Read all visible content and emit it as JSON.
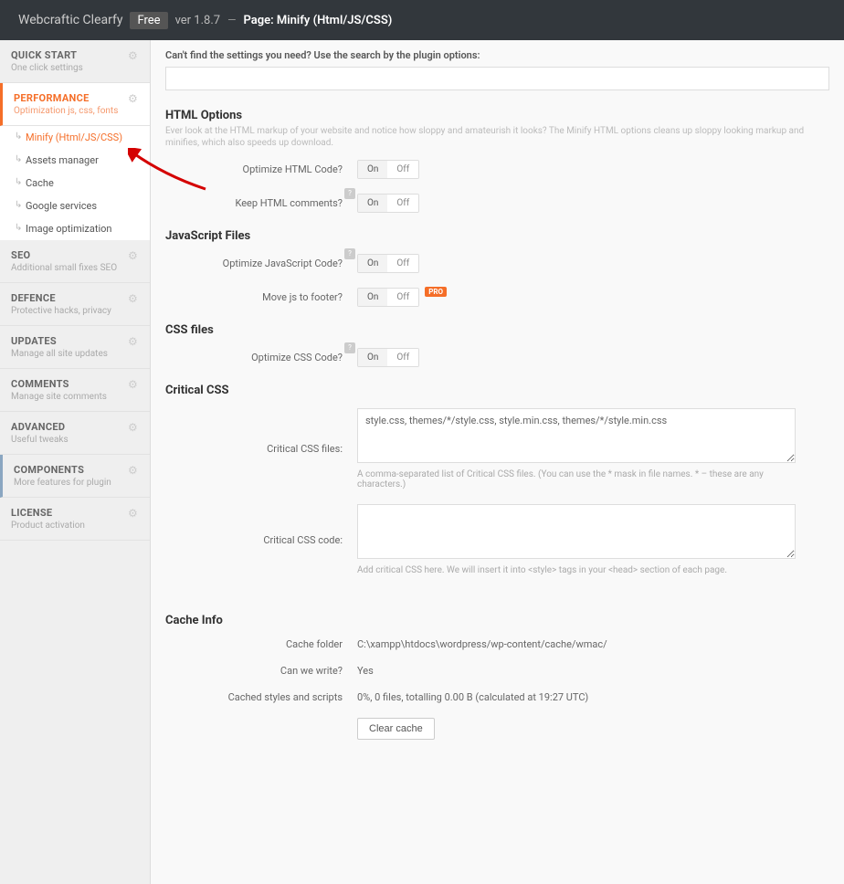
{
  "topbar": {
    "brand": "Webcraftic Clearfy",
    "plan": "Free",
    "version": "ver 1.8.7",
    "sep": "—",
    "page_prefix": "Page:",
    "page": "Minify (Html/JS/CSS)"
  },
  "sidebar": {
    "groups": [
      {
        "title": "QUICK START",
        "sub": "One click settings"
      },
      {
        "title": "PERFORMANCE",
        "sub": "Optimization js, css, fonts",
        "active": true,
        "items": [
          {
            "label": "Minify (Html/JS/CSS)",
            "sel": true
          },
          {
            "label": "Assets manager"
          },
          {
            "label": "Cache"
          },
          {
            "label": "Google services"
          },
          {
            "label": "Image optimization"
          }
        ]
      },
      {
        "title": "SEO",
        "sub": "Additional small fixes SEO"
      },
      {
        "title": "DEFENCE",
        "sub": "Protective hacks, privacy"
      },
      {
        "title": "UPDATES",
        "sub": "Manage all site updates"
      },
      {
        "title": "COMMENTS",
        "sub": "Manage site comments"
      },
      {
        "title": "ADVANCED",
        "sub": "Useful tweaks"
      },
      {
        "title": "COMPONENTS",
        "sub": "More features for plugin",
        "components": true
      },
      {
        "title": "LICENSE",
        "sub": "Product activation"
      }
    ]
  },
  "search": {
    "label": "Can't find the settings you need? Use the search by the plugin options:",
    "value": ""
  },
  "sections": {
    "html": {
      "title": "HTML Options",
      "desc": "Ever look at the HTML markup of your website and notice how sloppy and amateurish it looks? The Minify HTML options cleans up sloppy looking markup and minifies, which also speeds up download.",
      "rows": [
        {
          "label": "Optimize HTML Code?",
          "on": "On",
          "off": "Off"
        },
        {
          "label": "Keep HTML comments?",
          "on": "On",
          "off": "Off",
          "hint": "?"
        }
      ]
    },
    "js": {
      "title": "JavaScript Files",
      "rows": [
        {
          "label": "Optimize JavaScript Code?",
          "on": "On",
          "off": "Off",
          "hint": "?"
        },
        {
          "label": "Move js to footer?",
          "on": "On",
          "off": "Off",
          "pro": "PRO"
        }
      ]
    },
    "css": {
      "title": "CSS files",
      "rows": [
        {
          "label": "Optimize CSS Code?",
          "on": "On",
          "off": "Off",
          "hint": "?"
        }
      ]
    },
    "critical": {
      "title": "Critical CSS",
      "files_label": "Critical CSS files:",
      "files_value": "style.css, themes/*/style.css, style.min.css, themes/*/style.min.css",
      "files_help": "A comma-separated list of Critical CSS files. (You can use the * mask in file names. * – these are any characters.)",
      "code_label": "Critical CSS code:",
      "code_value": "",
      "code_help": "Add critical CSS here. We will insert it into <style> tags in your <head> section of each page."
    },
    "cache": {
      "title": "Cache Info",
      "rows": [
        {
          "label": "Cache folder",
          "value": "C:\\xampp\\htdocs\\wordpress/wp-content/cache/wmac/"
        },
        {
          "label": "Can we write?",
          "value": "Yes"
        },
        {
          "label": "Cached styles and scripts",
          "value": "0%, 0 files, totalling 0.00 B (calculated at 19:27 UTC)"
        }
      ],
      "clear_btn": "Clear cache"
    }
  },
  "toggle_labels": {
    "on": "On",
    "off": "Off"
  }
}
